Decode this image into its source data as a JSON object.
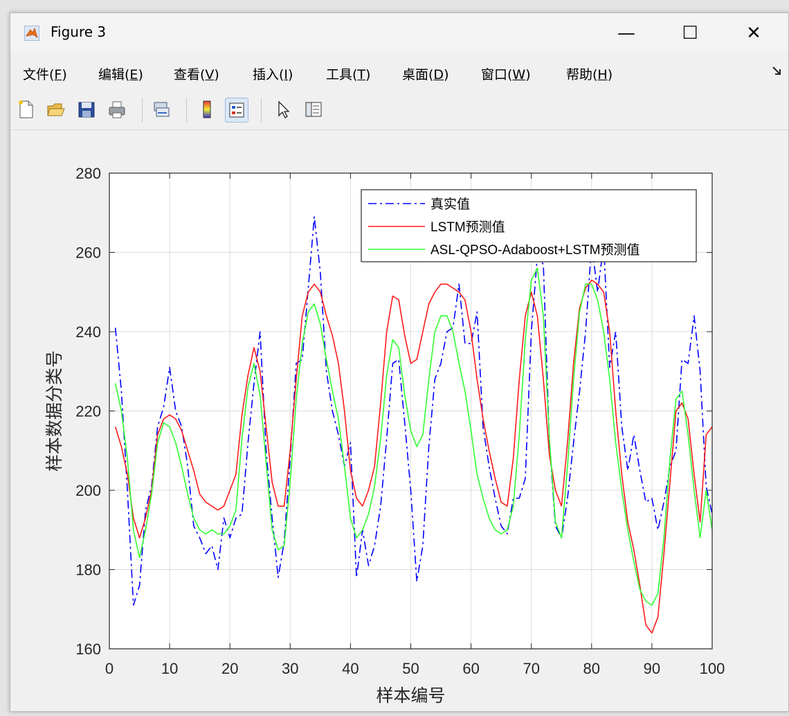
{
  "window": {
    "title": "Figure 3"
  },
  "window_controls": {
    "minimize": "—",
    "maximize": "☐",
    "close": "✕"
  },
  "menu": [
    {
      "label": "文件(",
      "key": "F",
      "end": ")"
    },
    {
      "label": "编辑(",
      "key": "E",
      "end": ")"
    },
    {
      "label": "查看(",
      "key": "V",
      "end": ")"
    },
    {
      "label": "插入(",
      "key": "I",
      "end": ")"
    },
    {
      "label": "工具(",
      "key": "T",
      "end": ")"
    },
    {
      "label": "桌面(",
      "key": "D",
      "end": ")"
    },
    {
      "label": "窗口(",
      "key": "W",
      "end": ")"
    },
    {
      "label": "帮助(",
      "key": "H",
      "end": ")"
    }
  ],
  "toolbar": [
    "new-figure-icon",
    "open-file-icon",
    "save-icon",
    "print-icon",
    "link-plot-icon",
    "colorbar-icon",
    "legend-icon",
    "pointer-icon",
    "property-inspector-icon"
  ],
  "chart_data": {
    "type": "line",
    "xlabel": "样本编号",
    "ylabel": "样本数据分类号",
    "xlim": [
      0,
      100
    ],
    "ylim": [
      160,
      280
    ],
    "xticks": [
      0,
      10,
      20,
      30,
      40,
      50,
      60,
      70,
      80,
      90,
      100
    ],
    "yticks": [
      160,
      180,
      200,
      220,
      240,
      260,
      280
    ],
    "grid": true,
    "legend_position": "top-right",
    "x": [
      1,
      2,
      3,
      4,
      5,
      6,
      7,
      8,
      9,
      10,
      11,
      12,
      13,
      14,
      15,
      16,
      17,
      18,
      19,
      20,
      21,
      22,
      23,
      24,
      25,
      26,
      27,
      28,
      29,
      30,
      31,
      32,
      33,
      34,
      35,
      36,
      37,
      38,
      39,
      40,
      41,
      42,
      43,
      44,
      45,
      46,
      47,
      48,
      49,
      50,
      51,
      52,
      53,
      54,
      55,
      56,
      57,
      58,
      59,
      60,
      61,
      62,
      63,
      64,
      65,
      66,
      67,
      68,
      69,
      70,
      71,
      72,
      73,
      74,
      75,
      76,
      77,
      78,
      79,
      80,
      81,
      82,
      83,
      84,
      85,
      86,
      87,
      88,
      89,
      90,
      91,
      92,
      93,
      94,
      95,
      96,
      97,
      98,
      99,
      100
    ],
    "series": [
      {
        "name": "真实值",
        "color": "#0000ff",
        "style": "dash-dot",
        "values": [
          241,
          225,
          200,
          171,
          176,
          195,
          201,
          216,
          221,
          231,
          220,
          216,
          206,
          191,
          188,
          184,
          186,
          180,
          193,
          188,
          193,
          194,
          212,
          227,
          240,
          210,
          193,
          178,
          187,
          208,
          232,
          233,
          251,
          269,
          255,
          230,
          220,
          214,
          206,
          212,
          178,
          190,
          181,
          186,
          196,
          213,
          232,
          233,
          217,
          200,
          177,
          186,
          211,
          228,
          232,
          240,
          241,
          252,
          237,
          237,
          245,
          216,
          206,
          198,
          191,
          189,
          198,
          198,
          203,
          240,
          259,
          257,
          212,
          191,
          188,
          198,
          212,
          225,
          240,
          262,
          250,
          262,
          231,
          240,
          216,
          205,
          214,
          205,
          197,
          198,
          190,
          197,
          206,
          210,
          233,
          232,
          244,
          230,
          201,
          194
        ]
      },
      {
        "name": "LSTM预测值",
        "color": "#ff1a1a",
        "style": "solid",
        "values": [
          216,
          211,
          204,
          193,
          188,
          193,
          200,
          214,
          218,
          219,
          218,
          215,
          210,
          205,
          199,
          197,
          196,
          195,
          196,
          200,
          204,
          219,
          229,
          236,
          230,
          216,
          202,
          196,
          196,
          210,
          228,
          244,
          250,
          252,
          250,
          244,
          239,
          232,
          220,
          205,
          198,
          196,
          200,
          206,
          222,
          240,
          249,
          248,
          239,
          232,
          233,
          240,
          247,
          250,
          252,
          252,
          251,
          250,
          248,
          240,
          228,
          218,
          210,
          203,
          197,
          196,
          208,
          228,
          244,
          250,
          244,
          228,
          209,
          200,
          196,
          212,
          232,
          246,
          251,
          253,
          252,
          250,
          240,
          220,
          204,
          192,
          185,
          176,
          166,
          164,
          168,
          184,
          202,
          220,
          222,
          218,
          204,
          192,
          214,
          216
        ]
      },
      {
        "name": "ASL-QPSO-Adaboost+LSTM预测值",
        "color": "#33ff33",
        "style": "solid",
        "values": [
          227,
          220,
          208,
          190,
          183,
          190,
          199,
          212,
          217,
          216,
          212,
          206,
          199,
          193,
          190,
          189,
          190,
          189,
          189,
          191,
          195,
          213,
          226,
          232,
          224,
          207,
          190,
          185,
          186,
          202,
          223,
          237,
          245,
          247,
          242,
          233,
          225,
          218,
          206,
          193,
          188,
          190,
          194,
          201,
          213,
          229,
          238,
          236,
          224,
          215,
          211,
          214,
          228,
          240,
          244,
          244,
          240,
          232,
          225,
          215,
          204,
          198,
          193,
          190,
          189,
          190,
          196,
          214,
          238,
          253,
          256,
          244,
          213,
          192,
          188,
          206,
          228,
          245,
          252,
          252,
          248,
          240,
          228,
          212,
          200,
          190,
          182,
          175,
          172,
          171,
          174,
          188,
          208,
          223,
          225,
          214,
          200,
          188,
          200,
          190
        ]
      }
    ]
  }
}
